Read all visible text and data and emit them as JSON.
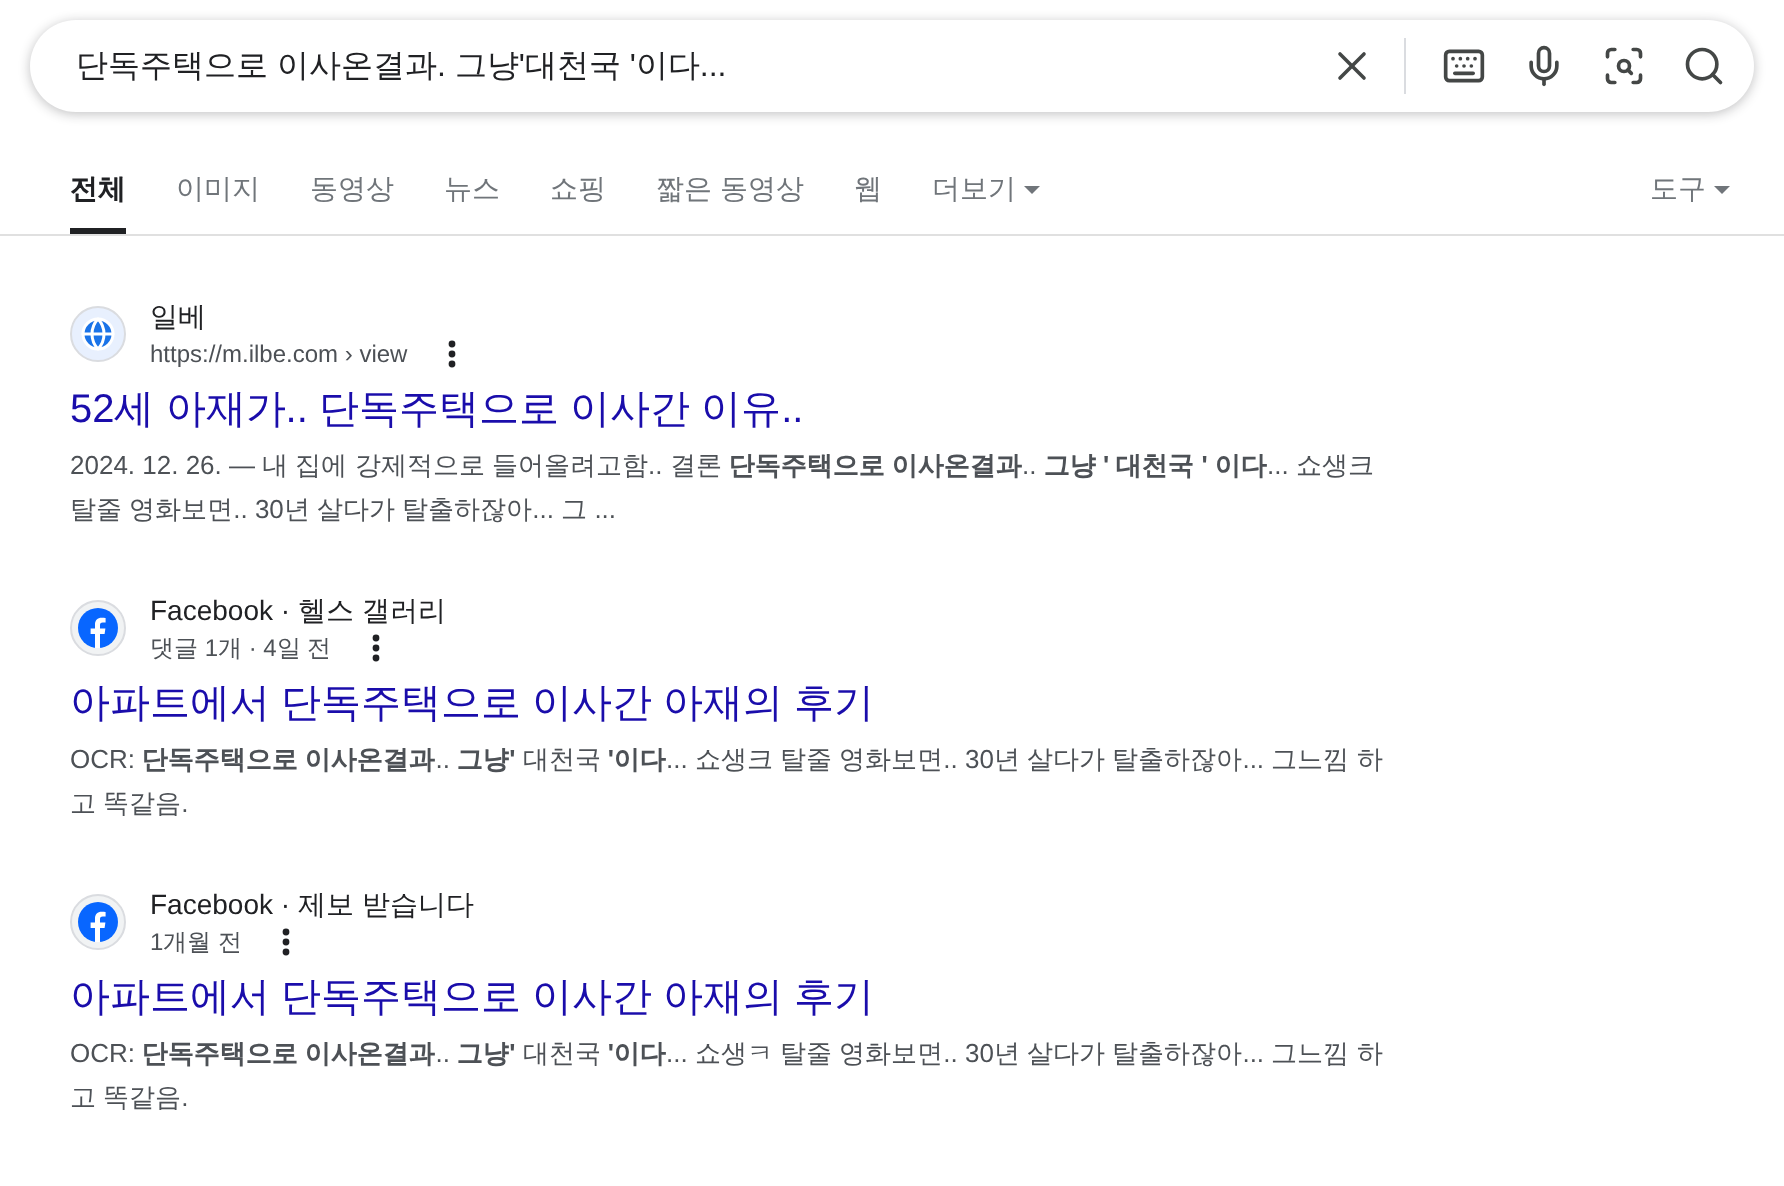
{
  "search": {
    "value": "단독주택으로 이사온결과. 그냥'대천국 '이다..."
  },
  "tabs": [
    {
      "label": "전체",
      "selected": true
    },
    {
      "label": "이미지",
      "selected": false
    },
    {
      "label": "동영상",
      "selected": false
    },
    {
      "label": "뉴스",
      "selected": false
    },
    {
      "label": "쇼핑",
      "selected": false
    },
    {
      "label": "짧은 동영상",
      "selected": false
    },
    {
      "label": "웹",
      "selected": false
    },
    {
      "label": "더보기",
      "selected": false,
      "dropdown": true
    }
  ],
  "tools": {
    "label": "도구"
  },
  "results": [
    {
      "kind": "globe",
      "site": "일베",
      "meta": "https://m.ilbe.com › view",
      "title": "52세 아재가.. 단독주택으로 이사간 이유..",
      "snippet": "2024. 12. 26. — 내 집에 강제적으로 들어올려고함.. 결론 **단독주택으로 이사온결과**.. **그냥 ' 대천국 ' 이다**... 쇼생크 탈줄 영화보면.. 30년 살다가 탈출하잖아... 그 ..."
    },
    {
      "kind": "facebook",
      "site": "Facebook · 헬스 갤러리",
      "meta": "댓글 1개 · 4일 전",
      "title": "아파트에서 단독주택으로 이사간 아재의 후기",
      "snippet": "OCR: **단독주택으로 이사온결과**.. **그냥'** 대천국 **'이다**... 쇼생크 탈줄 영화보면.. 30년 살다가 탈출하잖아... 그느낌 하고 똑같음."
    },
    {
      "kind": "facebook",
      "site": "Facebook · 제보 받습니다",
      "meta": "1개월 전",
      "title": "아파트에서 단독주택으로 이사간 아재의 후기",
      "snippet": "OCR: **단독주택으로 이사온결과**.. **그냥'** 대천국 **'이다**... 쇼생ㅋ 탈줄 영화보면.. 30년 살다가 탈출하잖아... 그느낌 하고 똑같음."
    }
  ]
}
